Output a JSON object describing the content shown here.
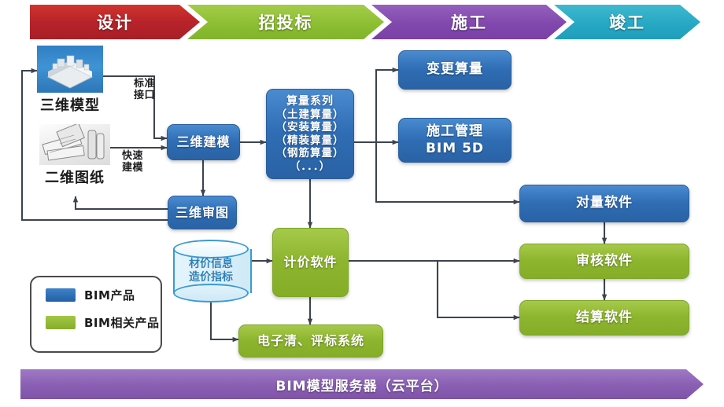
{
  "phases": [
    {
      "label": "设计",
      "color": "#b8232a",
      "kind": "start"
    },
    {
      "label": "招投标",
      "color": "#8dbf33",
      "kind": "mid"
    },
    {
      "label": "施工",
      "color": "#8148ad",
      "kind": "mid"
    },
    {
      "label": "竣工",
      "color": "#26a8c4",
      "kind": "end"
    }
  ],
  "sources": {
    "model": {
      "caption": "三维模型",
      "icon": "building-3d-model-thumbnail"
    },
    "drawing": {
      "caption": "二维图纸",
      "icon": "blueprint-rolls-thumbnail"
    }
  },
  "edge_labels": {
    "standard_interface": "标准\n接口",
    "standard_interface_line1": "标准",
    "standard_interface_line2": "接口",
    "rapid_modeling_line1": "快速",
    "rapid_modeling_line2": "建模"
  },
  "nodes": {
    "modeling": {
      "label": "三维建模",
      "type": "BIM产品",
      "color": "#2f6db4"
    },
    "review": {
      "label": "三维审图",
      "type": "BIM产品",
      "color": "#2f6db4"
    },
    "quantity_series": {
      "title": "算量系列",
      "items": [
        "（土建算量）",
        "（安装算量）",
        "（精装算量）",
        "（钢筋算量）",
        "（．．．）"
      ],
      "type": "BIM产品",
      "color": "#2f6db4"
    },
    "change_quantity": {
      "label": "变更算量",
      "type": "BIM产品",
      "color": "#2f6db4"
    },
    "construction_mgmt": {
      "line1": "施工管理",
      "line2": "BIM 5D",
      "type": "BIM产品",
      "color": "#2f6db4"
    },
    "check_quantity_sw": {
      "label": "对量软件",
      "type": "BIM产品",
      "color": "#2f6db4"
    },
    "audit_sw": {
      "label": "审核软件",
      "type": "BIM相关产品",
      "color": "#8db52e"
    },
    "settlement_sw": {
      "label": "结算软件",
      "type": "BIM相关产品",
      "color": "#8db52e"
    },
    "pricing_sw": {
      "label": "计价软件",
      "type": "BIM相关产品",
      "color": "#8db52e"
    },
    "bidding_system": {
      "label": "电子清、评标系统",
      "type": "BIM相关产品",
      "color": "#8db52e"
    },
    "price_database": {
      "line1": "材价信息",
      "line2": "造价指标",
      "shape": "cylinder",
      "color": "#3b9ad1"
    }
  },
  "legend": {
    "items": [
      {
        "label": "BIM产品",
        "color": "#2160a4"
      },
      {
        "label": "BIM相关产品",
        "color": "#86ae2a"
      }
    ]
  },
  "footer": {
    "label": "BIM模型服务器（云平台）",
    "color": "#8a5fb3"
  }
}
